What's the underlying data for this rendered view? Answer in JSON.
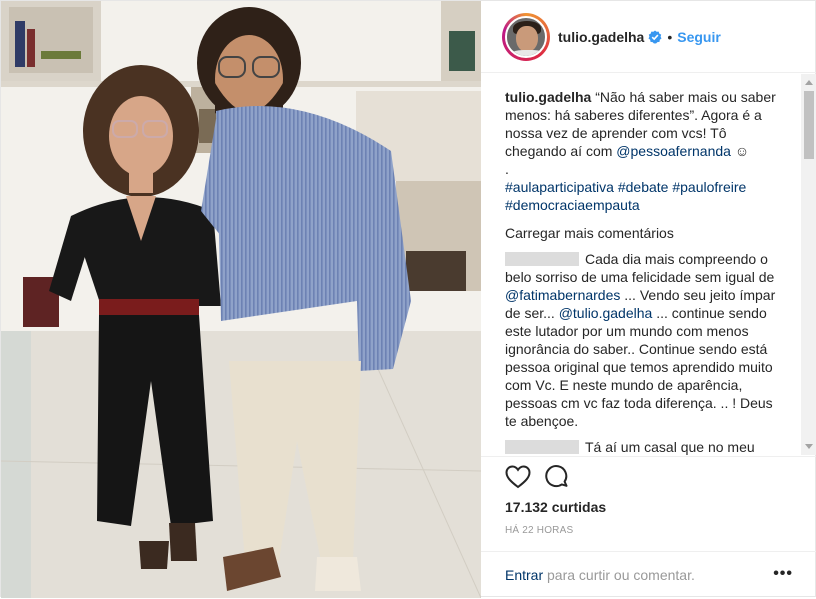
{
  "post": {
    "username": "tulio.gadelha",
    "follow_label": "Seguir",
    "separator": "•",
    "caption": {
      "username": "tulio.gadelha",
      "text": "“Não há saber mais ou saber menos: há saberes diferentes”. Agora é a nossa vez de aprender com vcs! Tô chegando aí com",
      "mention": "@pessoafernanda",
      "emoji": "☺",
      "dot": ".",
      "hashtags": [
        "#aulaparticipativa",
        "#debate",
        "#paulofreire",
        "#democraciaempauta"
      ]
    },
    "load_more_label": "Carregar mais comentários",
    "comments": [
      {
        "text_a": "Cada dia mais compreendo o belo sorriso de uma felicidade sem igual de",
        "mention_a": "@fatimabernardes",
        "text_b": "... Vendo seu jeito ímpar de ser...",
        "mention_b": "@tulio.gadelha",
        "text_c": "... continue sendo este lutador por um mundo com menos ignorância do saber.. Continue sendo está pessoa original que temos aprendido muito com Vc. E neste mundo de aparência, pessoas cm vc faz toda diferença. .. ! Deus te abençoe."
      },
      {
        "text_a": "Tá aí um casal que no meu"
      }
    ],
    "likes_label": "17.132 curtidas",
    "time_label": "HÁ 22 HORAS",
    "login_link": "Entrar",
    "login_text": "para curtir ou comentar.",
    "options_label": "•••"
  },
  "colors": {
    "link": "#003569",
    "follow": "#3897f0",
    "verified": "#3897f0",
    "muted": "#999999"
  },
  "icons": [
    "verified-badge-icon",
    "heart-icon",
    "comment-icon",
    "more-options-icon"
  ]
}
